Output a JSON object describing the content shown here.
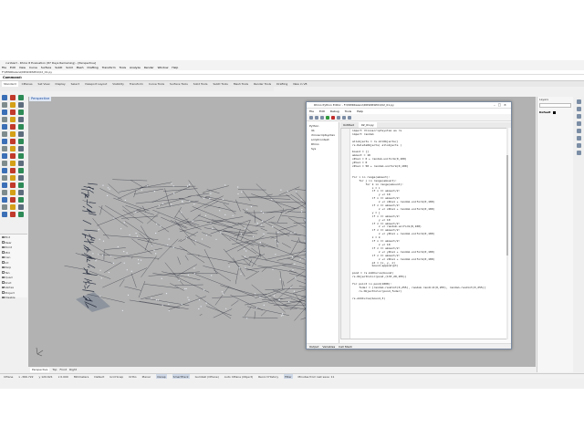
{
  "window": {
    "title": "curlAlert - Rhino 8 Evaluation (87 Days Remaining) - [Perspective]"
  },
  "menu": [
    "File",
    "Edit",
    "View",
    "Curve",
    "Surface",
    "SubD",
    "Solid",
    "Mesh",
    "Drafting",
    "Transform",
    "Tools",
    "Analyze",
    "Render",
    "Window",
    "Help"
  ],
  "file_path": "F:\\MWRKalenz\\DRSDRSP01\\02_01.py",
  "command": {
    "label": "Command:"
  },
  "toolbar_tabs": [
    "Standard",
    "CPlanes",
    "Set View",
    "Display",
    "Select",
    "Viewport Layout",
    "Visibility",
    "Transform",
    "Curve Tools",
    "Surface Tools",
    "Solid Tools",
    "SubD Tools",
    "Mesh Tools",
    "Render Tools",
    "Drafting",
    "New in V8"
  ],
  "viewport": {
    "label": "Perspective",
    "tabs": [
      "Perspective",
      "Top",
      "Front",
      "Right"
    ]
  },
  "osnap": [
    "End",
    "Near",
    "Point",
    "Mid",
    "Cen",
    "Int",
    "Perp",
    "Tan",
    "Quad",
    "Knot",
    "Vertex",
    "Project",
    "Disable"
  ],
  "layers": {
    "header": "Layers",
    "default_layer": "Default"
  },
  "statusbar": [
    "CPlane",
    "x -366.722",
    "y 120.621",
    "z 0.000",
    "Millimeters",
    "Default",
    "Grid Snap",
    "Ortho",
    "Planar",
    "Osnap",
    "SmartTrack",
    "Gumball (CPlane)",
    "Auto CPlane (Object)",
    "Record History",
    "Filter",
    "Minutes from last save: 11"
  ],
  "editor": {
    "title": "Rhino Python Editor - F:\\MWRKalenz\\DRSDRSP01\\02_01.py",
    "menu": [
      "File",
      "Edit",
      "Debug",
      "Tools",
      "Help"
    ],
    "tree": [
      "Python",
      "lib",
      "rhinoscriptsyntax",
      "scriptcontext",
      "Rhino",
      "Sys"
    ],
    "tabs": [
      "Untitled",
      "02_01.py"
    ],
    "code": [
      "import rhinoscriptsyntax as rs",
      "import random",
      "",
      "allobjects = rs.AllObjects()",
      "rs.DeleteObjects( allobjects )",
      "",
      "bound = []",
      "amount = 10",
      "xPos1 = 0 + random.uniform(0,100)",
      "yPos1 = 0",
      "zPos1 = 50 + random.uniform(0,100)",
      "",
      "",
      "for i in range(amount):",
      "    for j in range(amount):",
      "        for k in range(amount):",
      "            x = i",
      "            if x == amount/2:",
      "                y += 10",
      "            if x == amount/2:",
      "                z += xPos1 + random.uniform(0,100)",
      "            if z == amount/2:",
      "                z += xPos1 + random.uniform(0,100)",
      "            y = j",
      "            if x == amount/2:",
      "                y += 10",
      "            if z == amount/2:",
      "                z += random.uniform(0,100)",
      "            if z == amount/2:",
      "                z += yPos1 + random.uniform(0,100)",
      "            z = k",
      "            if x == amount/2:",
      "                z += 10",
      "            if z == amount/2:",
      "                z += yPos1 + random.uniform(0,100)",
      "            if z == amount/2:",
      "                z += zPos1 + random.uniform(0,100)",
      "            pt = [x, y, z]",
      "            bound.append(pt)",
      "",
      "pond = rs.AddCurve(bound)",
      "rs.ObjectColor(pond,(133,20,255))",
      "",
      "for point in pond(1000):",
      "    foder = [random.randint(0,255), random.randint(0,255), random.randint(0,255)]",
      "    rs.ObjectColor(pond,foder)",
      "",
      "rs.AddCurve(bound,3)"
    ],
    "footer": [
      "Output",
      "Variables",
      "Call Stack"
    ]
  },
  "colors": {
    "viewport_bg": "#b2b2b2",
    "curves": "#1e2130",
    "points": "#e8edf5",
    "accent": "#1b4b9c"
  }
}
